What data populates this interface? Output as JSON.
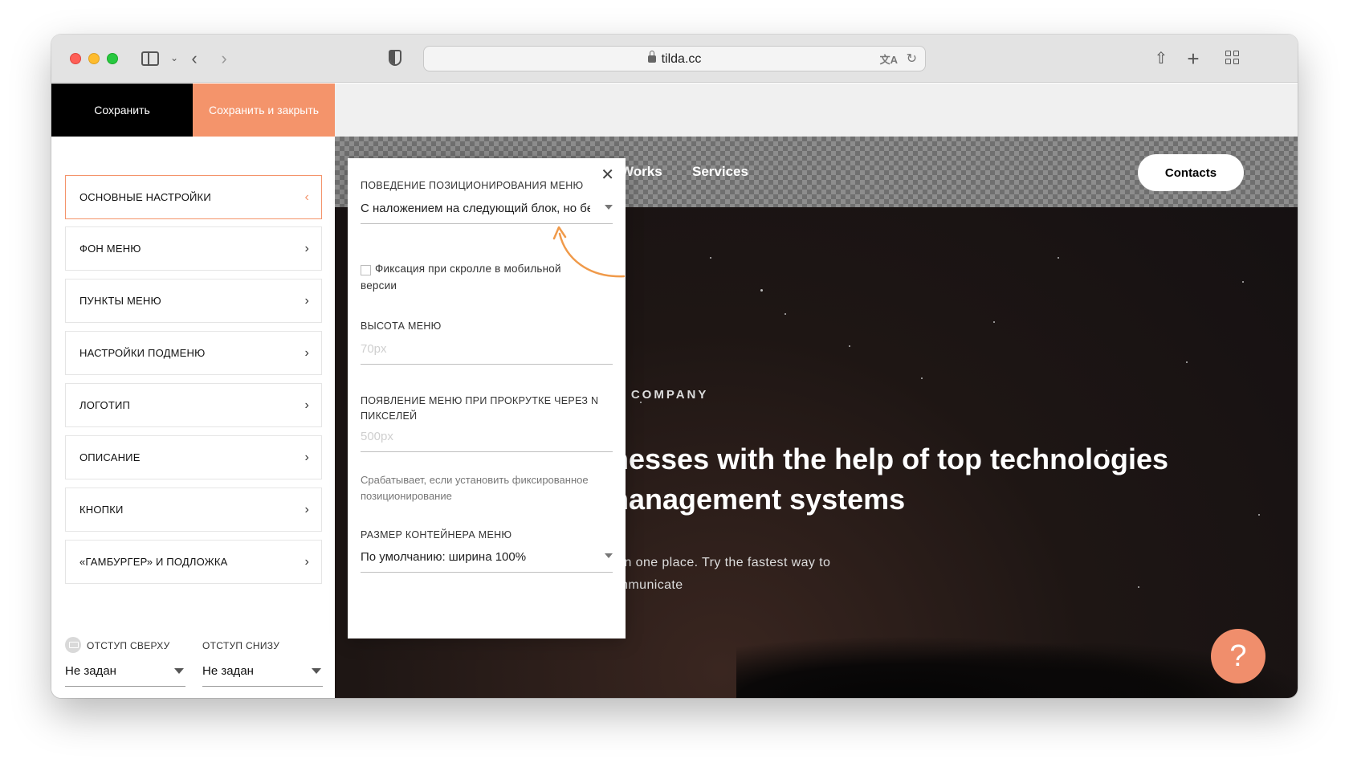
{
  "browser": {
    "url": "tilda.cc"
  },
  "editor": {
    "save_label": "Сохранить",
    "save_close_label": "Сохранить и закрыть"
  },
  "settings_menu": {
    "items": [
      {
        "label": "Основные настройки"
      },
      {
        "label": "Фон меню"
      },
      {
        "label": "Пункты меню"
      },
      {
        "label": "Настройки подменю"
      },
      {
        "label": "Логотип"
      },
      {
        "label": "Описание"
      },
      {
        "label": "Кнопки"
      },
      {
        "label": "«Гамбургер» и подложка"
      }
    ],
    "padding_top_label": "Отступ сверху",
    "padding_top_value": "Не задан",
    "padding_bottom_label": "Отступ снизу",
    "padding_bottom_value": "Не задан"
  },
  "popup": {
    "positioning_label": "Поведение позиционирования меню",
    "positioning_value": "С наложением на следующий блок, но бе",
    "fix_mobile_label": "Фиксация при скролле в мобильной версии",
    "height_label": "Высота меню",
    "height_placeholder": "70px",
    "appear_label": "Появление меню при прокрутке через N пикселей",
    "appear_placeholder": "500px",
    "appear_hint": "Срабатывает, если установить фиксированное позиционирование",
    "container_label": "Размер контейнера меню",
    "container_value": "По умолчанию: ширина 100%"
  },
  "preview": {
    "nav": [
      "Works",
      "Services"
    ],
    "contacts_label": "Contacts",
    "kicker": "UR COMPANY",
    "title_line1": "inesses with the help of top technologies",
    "title_line2": "management systems",
    "sub_line1": "se in one place. Try the fastest way to",
    "sub_line2": "communicate",
    "help_label": "?"
  },
  "colors": {
    "accent": "#f4946b",
    "save_bg": "#000000",
    "help_bg": "#f08e6c"
  }
}
